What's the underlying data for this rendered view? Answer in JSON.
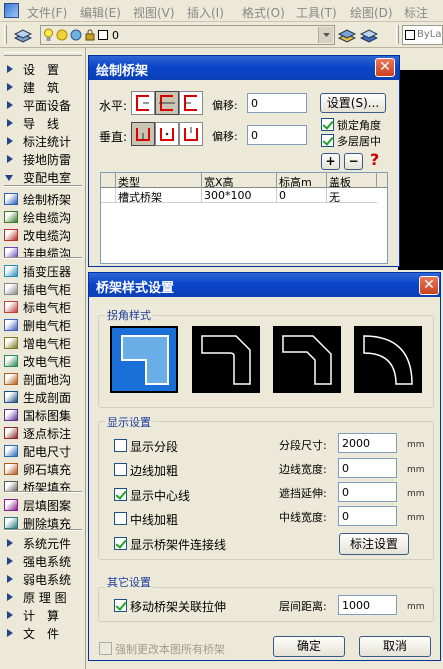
{
  "menubar": {
    "items": [
      "文件(F)",
      "编辑(E)",
      "视图(V)",
      "插入(I)",
      "格式(O)",
      "工具(T)",
      "绘图(D)",
      "标注(N)"
    ]
  },
  "toolbar": {
    "layer_value": "0",
    "linetype_value": "ByLa"
  },
  "left_panel": {
    "items": [
      {
        "label": "设　置",
        "type": "arrow"
      },
      {
        "label": "建　筑",
        "type": "arrow"
      },
      {
        "label": "平面设备",
        "type": "arrow"
      },
      {
        "label": "导　线",
        "type": "arrow"
      },
      {
        "label": "标注统计",
        "type": "arrow"
      },
      {
        "label": "接地防雷",
        "type": "arrow"
      },
      {
        "label": "变配电室",
        "type": "arrow-down"
      },
      {
        "label": "绘制桥架",
        "type": "icon",
        "icon": "bridge-draw-icon"
      },
      {
        "label": "绘电缆沟",
        "type": "icon",
        "icon": "cable-trench-icon"
      },
      {
        "label": "改电缆沟",
        "type": "icon",
        "icon": "edit-cable-trench-icon"
      },
      {
        "label": "连电缆沟",
        "type": "icon",
        "icon": "connect-cable-trench-icon"
      },
      {
        "label": "插变压器",
        "type": "icon",
        "icon": "transformer-icon"
      },
      {
        "label": "插电气柜",
        "type": "icon",
        "icon": "cabinet-icon"
      },
      {
        "label": "标电气柜",
        "type": "icon",
        "icon": "label-cabinet-icon"
      },
      {
        "label": "删电气柜",
        "type": "icon",
        "icon": "delete-cabinet-icon"
      },
      {
        "label": "增电气柜",
        "type": "icon",
        "icon": "add-cabinet-icon"
      },
      {
        "label": "改电气柜",
        "type": "icon",
        "icon": "modify-cabinet-icon"
      },
      {
        "label": "剖面地沟",
        "type": "icon",
        "icon": "section-trench-icon"
      },
      {
        "label": "生成剖面",
        "type": "icon",
        "icon": "generate-section-icon"
      },
      {
        "label": "国标图集",
        "type": "icon",
        "icon": "atlas-icon"
      },
      {
        "label": "逐点标注",
        "type": "icon",
        "icon": "point-label-icon"
      },
      {
        "label": "配电尺寸",
        "type": "icon",
        "icon": "dimension-icon"
      },
      {
        "label": "卵石填充",
        "type": "icon",
        "icon": "pebble-fill-icon"
      },
      {
        "label": "桥架填充",
        "type": "icon",
        "icon": "bridge-fill-icon"
      },
      {
        "label": "层填图案",
        "type": "icon",
        "icon": "layer-pattern-icon"
      },
      {
        "label": "删除填充",
        "type": "icon",
        "icon": "delete-fill-icon"
      },
      {
        "label": "系统元件",
        "type": "arrow"
      },
      {
        "label": "强电系统",
        "type": "arrow"
      },
      {
        "label": "弱电系统",
        "type": "arrow"
      },
      {
        "label": "原 理 图",
        "type": "arrow"
      },
      {
        "label": "计　算",
        "type": "arrow"
      },
      {
        "label": "文　件",
        "type": "arrow"
      }
    ]
  },
  "draw_dialog": {
    "title": "绘制桥架",
    "horizontal_label": "水平:",
    "vertical_label": "垂直:",
    "offset_label": "偏移:",
    "h_offset": "0",
    "v_offset": "0",
    "settings_button": "设置(S)...",
    "lock_angle": "锁定角度",
    "multilayer_center": "多层居中",
    "add_button": "+",
    "remove_button": "−",
    "help_button": "?",
    "table": {
      "headers": [
        "类型",
        "宽X高",
        "标高m",
        "盖板"
      ],
      "rows": [
        [
          "槽式桥架",
          "300*100",
          "0",
          "无"
        ]
      ]
    }
  },
  "style_dialog": {
    "title": "桥架样式设置",
    "corner_group": "拐角样式",
    "display_group": "显示设置",
    "other_group": "其它设置",
    "checks": [
      {
        "label": "显示分段",
        "checked": false
      },
      {
        "label": "边线加粗",
        "checked": false
      },
      {
        "label": "显示中心线",
        "checked": true
      },
      {
        "label": "中线加粗",
        "checked": false
      },
      {
        "label": "显示桥架件连接线",
        "checked": true
      }
    ],
    "fields": [
      {
        "label": "分段尺寸:",
        "value": "2000",
        "unit": "mm"
      },
      {
        "label": "边线宽度:",
        "value": "0",
        "unit": "mm"
      },
      {
        "label": "遮挡延伸:",
        "value": "0",
        "unit": "mm"
      },
      {
        "label": "中线宽度:",
        "value": "0",
        "unit": "mm"
      }
    ],
    "label_settings_button": "标注设置",
    "move_linkage": {
      "label": "移动桥架关联拉伸",
      "checked": true
    },
    "floor_gap_label": "层间距离:",
    "floor_gap_value": "1000",
    "floor_gap_unit": "mm",
    "force_all": "强制更改本图所有桥架",
    "ok_button": "确定",
    "cancel_button": "取消"
  },
  "colors": {
    "title_bar": "#0a46c9",
    "selected_preview": "#1b6fd8",
    "panel": "#ece9d8"
  }
}
